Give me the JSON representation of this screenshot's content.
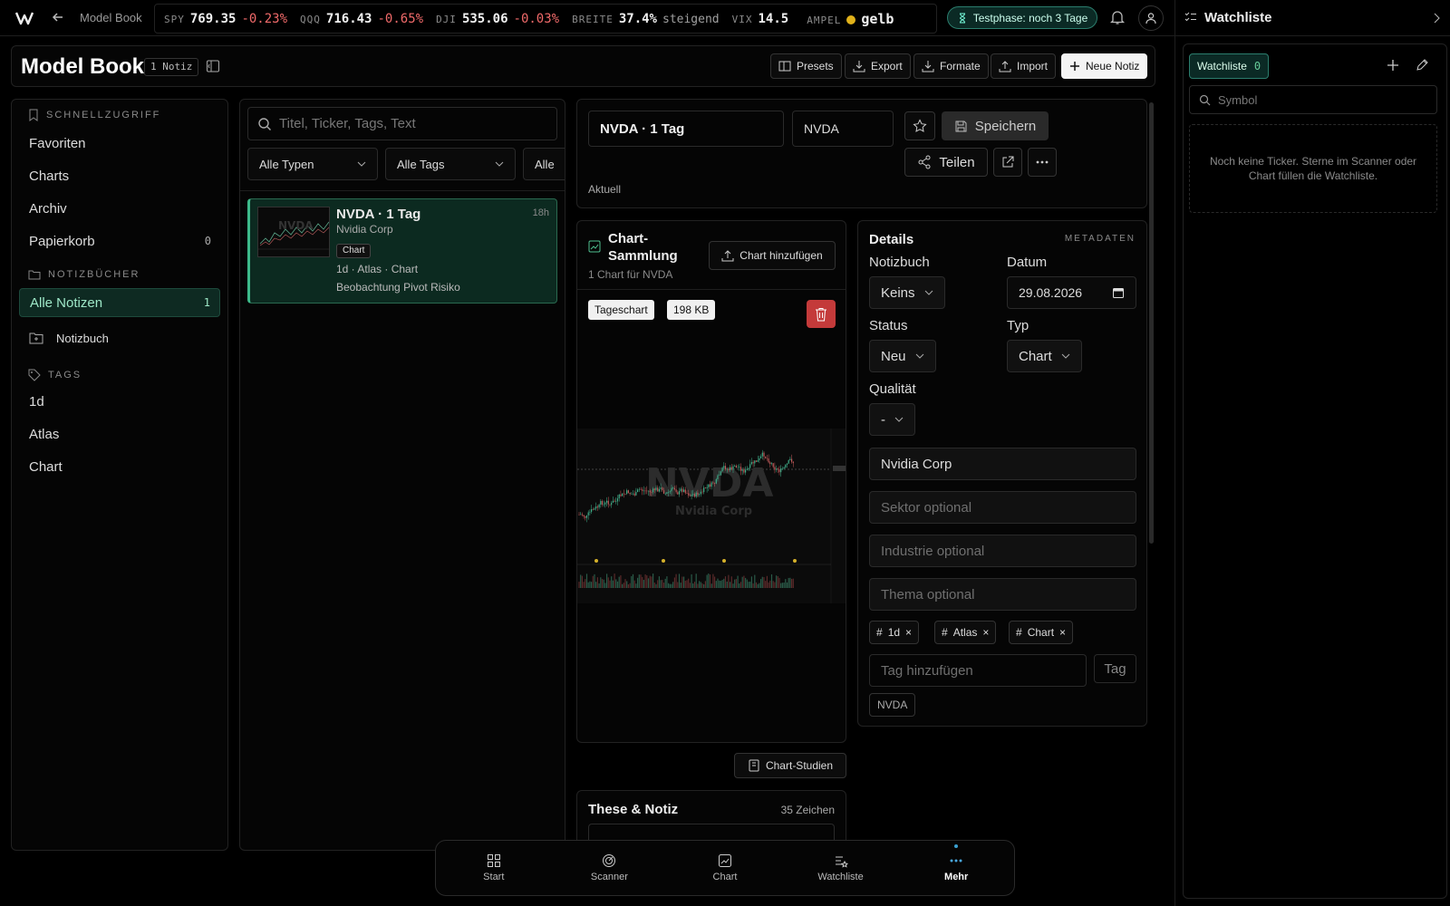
{
  "topbar": {
    "app_title": "Model Book",
    "tickers": [
      {
        "symbol": "SPY",
        "value": "769.35",
        "change": "-0.23%"
      },
      {
        "symbol": "QQQ",
        "value": "716.43",
        "change": "-0.65%"
      },
      {
        "symbol": "DJI",
        "value": "535.06",
        "change": "-0.03%"
      }
    ],
    "breadth": {
      "label": "BREITE",
      "value": "37.4%",
      "trend": "steigend"
    },
    "vix": {
      "label": "VIX",
      "value": "14.5"
    },
    "ampel": {
      "label": "AMPEL",
      "value": "gelb",
      "color": "#e0b11a"
    },
    "trial": "Testphase: noch 3 Tage",
    "icons": {
      "logo": "logo-icon",
      "back": "arrow-left-icon",
      "bell": "bell-icon",
      "user": "user-icon"
    }
  },
  "header": {
    "title": "Model Book",
    "note_count": "1 Notiz",
    "buttons": {
      "presets": "Presets",
      "export": "Export",
      "formats": "Formate",
      "import": "Import",
      "new_note": "Neue Notiz"
    }
  },
  "sidebar": {
    "quick_access_heading": "SCHNELLZUGRIFF",
    "quick_access": [
      {
        "label": "Favoriten",
        "count": ""
      },
      {
        "label": "Charts",
        "count": ""
      },
      {
        "label": "Archiv",
        "count": ""
      },
      {
        "label": "Papierkorb",
        "count": "0"
      }
    ],
    "notebooks_heading": "NOTIZBÜCHER",
    "all_notes": {
      "label": "Alle Notizen",
      "count": "1"
    },
    "notebook": "Notizbuch",
    "tags_heading": "TAGS",
    "tags": [
      "1d",
      "Atlas",
      "Chart"
    ]
  },
  "list": {
    "search_placeholder": "Titel, Ticker, Tags, Text",
    "filters": {
      "types": "Alle Typen",
      "tags": "Alle Tags",
      "third": "Alle"
    },
    "note": {
      "title": "NVDA · 1 Tag",
      "company": "Nvidia Corp",
      "time": "18h",
      "badge": "Chart",
      "meta": "1d · Atlas · Chart",
      "tags_line": "Beobachtung Pivot Risiko"
    }
  },
  "editor": {
    "title_value": "NVDA · 1 Tag",
    "ticker_value": "NVDA",
    "save": "Speichern",
    "share": "Teilen",
    "status_line": "Aktuell"
  },
  "chart_collection": {
    "title": "Chart-Sammlung",
    "subtitle": "1 Chart für NVDA",
    "add_button": "Chart hinzufügen",
    "image_label": "Tageschart",
    "image_size": "198 KB",
    "watermark_ticker": "NVDA",
    "watermark_company": "Nvidia Corp",
    "studies_button": "Chart-Studien"
  },
  "thesis": {
    "title": "These & Notiz",
    "count": "35 Zeichen"
  },
  "details": {
    "title": "Details",
    "meta_label": "METADATEN",
    "notebook_label": "Notizbuch",
    "notebook_value": "Keins",
    "date_label": "Datum",
    "date_value": "29.08.2026",
    "status_label": "Status",
    "status_value": "Neu",
    "type_label": "Typ",
    "type_value": "Chart",
    "quality_label": "Qualität",
    "quality_value": "-",
    "company_value": "Nvidia Corp",
    "sector_placeholder": "Sektor optional",
    "industry_placeholder": "Industrie optional",
    "theme_placeholder": "Thema optional",
    "tags": [
      "1d",
      "Atlas",
      "Chart"
    ],
    "tag_add_placeholder": "Tag hinzufügen",
    "tag_button": "Tag",
    "ticker_chip": "NVDA"
  },
  "watchlist": {
    "title": "Watchliste",
    "tab_label": "Watchliste",
    "tab_count": "0",
    "search_placeholder": "Symbol",
    "empty_text": "Noch keine Ticker. Sterne im Scanner oder Chart füllen die Watchliste."
  },
  "bottom_nav": {
    "items": [
      {
        "label": "Start",
        "icon": "grid-icon"
      },
      {
        "label": "Scanner",
        "icon": "radar-icon"
      },
      {
        "label": "Chart",
        "icon": "chart-icon"
      },
      {
        "label": "Watchliste",
        "icon": "watchlist-icon"
      },
      {
        "label": "Mehr",
        "icon": "more-icon"
      }
    ],
    "active": "Mehr"
  }
}
